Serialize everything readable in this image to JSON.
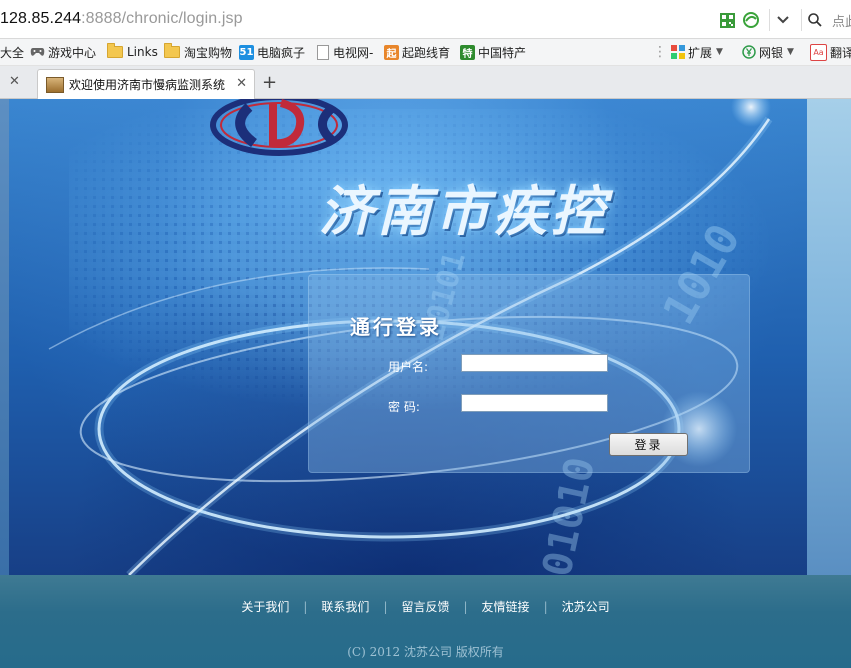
{
  "address_bar": {
    "url_host": "128.85.244",
    "url_path": ":8888/chronic/login.jsp",
    "search_placeholder": "点此"
  },
  "bookmarks": {
    "items": [
      {
        "label": "大全"
      },
      {
        "label": "游戏中心"
      },
      {
        "label": "Links"
      },
      {
        "label": "淘宝购物"
      },
      {
        "label": "电脑疯子",
        "badge": "51"
      },
      {
        "label": "电视网-"
      },
      {
        "label": "起跑线育",
        "badge": "起"
      },
      {
        "label": "中国特产",
        "badge": "特"
      }
    ],
    "ext_label": "扩展",
    "bank_label": "网银",
    "translate_label": "翻译",
    "translate_badge": "Aa"
  },
  "tabs": {
    "active_title": "欢迎使用济南市慢病监测系统"
  },
  "page": {
    "site_title": "济南市疾控",
    "login": {
      "heading": "通行登录",
      "username_label": "用户名:",
      "username_value": "",
      "password_label": "密  码:",
      "password_value": "",
      "submit_label": "登录"
    },
    "footer": {
      "links": [
        "关于我们",
        "联系我们",
        "留言反馈",
        "友情链接",
        "沈苏公司"
      ],
      "copyright": "(C) 2012 沈苏公司  版权所有"
    },
    "decor_binary_1": "1010",
    "decor_binary_2": "01010",
    "decor_binary_3": "10101"
  },
  "colors": {
    "banner_blue": "#1f5fae",
    "footer_teal": "#2c6d8b",
    "title_glow": "#7ec8ff"
  }
}
